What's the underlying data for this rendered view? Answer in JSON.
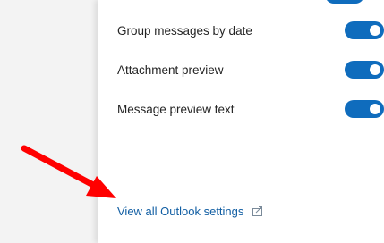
{
  "settings": {
    "items": [
      {
        "label": "Group messages by date",
        "enabled": true
      },
      {
        "label": "Attachment preview",
        "enabled": true
      },
      {
        "label": "Message preview text",
        "enabled": true
      }
    ],
    "footer_link": "View all Outlook settings",
    "footer_link_icon": "external-link-icon"
  },
  "colors": {
    "accent": "#0f6cbd",
    "link": "#115ea3",
    "annotation_arrow": "#ff0000"
  }
}
